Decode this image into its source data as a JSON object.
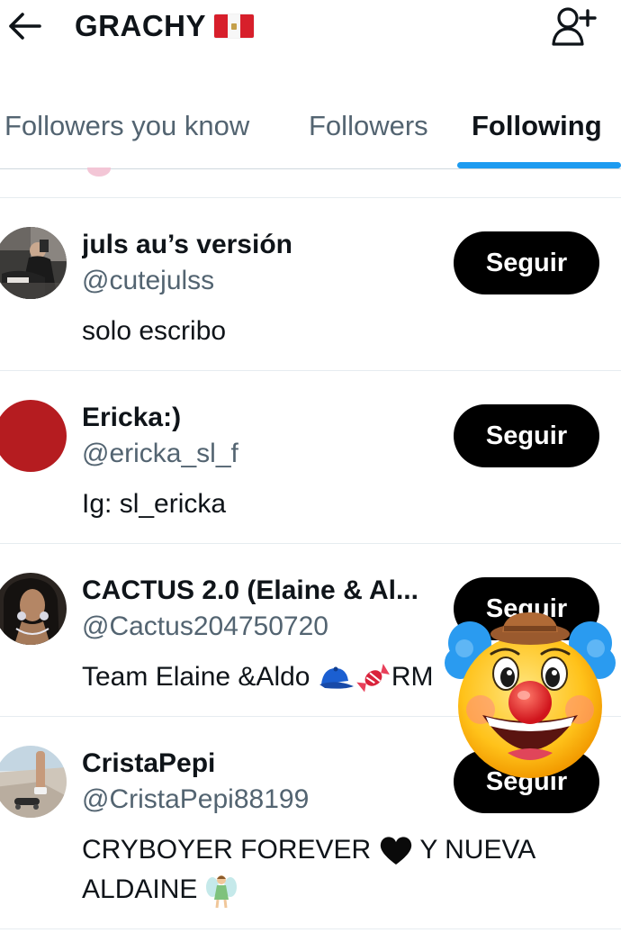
{
  "header": {
    "title": "GRACHY",
    "flag_icon": "peru-flag-emoji",
    "back_icon": "arrow-left-icon",
    "add_icon": "person-add-icon"
  },
  "tabs": [
    {
      "label": "Followers you know",
      "active": false
    },
    {
      "label": "Followers",
      "active": false
    },
    {
      "label": "Following",
      "active": true
    }
  ],
  "accent_color": "#1d9bf0",
  "users": [
    {
      "name": "juls au’s versión",
      "handle": "@cutejulss",
      "bio": "solo escribo",
      "button": "Seguir"
    },
    {
      "name": "Ericka:)",
      "handle": "@ericka_sl_f",
      "bio": "Ig: sl_ericka",
      "button": "Seguir",
      "avatar_color": "#b51c20"
    },
    {
      "name": "CACTUS 2.0 (Elaine & Al...",
      "handle": "@Cactus204750720",
      "bio_text": "Team Elaine &Aldo ",
      "bio_suffix": "RM",
      "bio_emojis": [
        "blue-cap-emoji",
        "candy-emoji"
      ],
      "button": "Seguir"
    },
    {
      "name": "CristaPepi",
      "handle": "@CristaPepi88199",
      "bio_line1": "CRYBOYER FOREVER ",
      "bio_line1_end": " Y NUEVA",
      "bio_line2": "ALDAINE ",
      "bio_emojis": [
        "black-heart-emoji",
        "fairy-emoji"
      ],
      "button": "Seguir"
    }
  ],
  "overlay": {
    "icon": "clown-face-emoji"
  }
}
